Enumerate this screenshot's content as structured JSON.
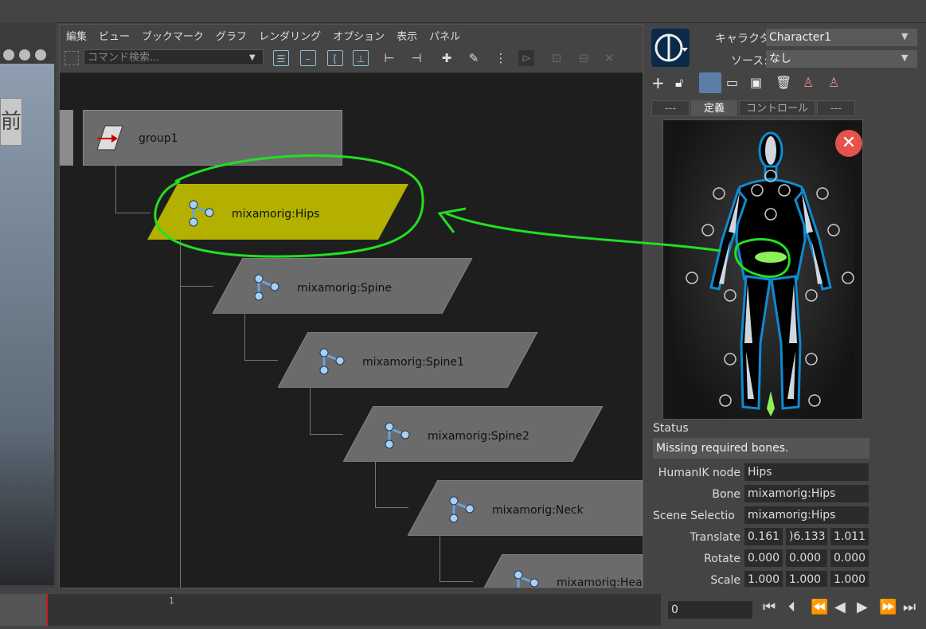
{
  "node_editor": {
    "menu": [
      "編集",
      "ビュー",
      "ブックマーク",
      "グラフ",
      "レンダリング",
      "オプション",
      "表示",
      "パネル"
    ],
    "search_placeholder": "コマンド検索..."
  },
  "nodes": [
    {
      "label": "group1",
      "selected": false
    },
    {
      "label": "mixamorig:Hips",
      "selected": true
    },
    {
      "label": "mixamorig:Spine",
      "selected": false
    },
    {
      "label": "mixamorig:Spine1",
      "selected": false
    },
    {
      "label": "mixamorig:Spine2",
      "selected": false
    },
    {
      "label": "mixamorig:Neck",
      "selected": false
    },
    {
      "label": "mixamorig:Hea",
      "selected": false
    }
  ],
  "viewport": {
    "button_text": "前"
  },
  "hik": {
    "character_label": "キャラクタ:",
    "character_value": "Character1",
    "source_label": "ソース:",
    "source_value": "なし",
    "tabs": [
      "---",
      "定義",
      "コントロール",
      "---"
    ],
    "active_tab": "定義",
    "status_header": "Status",
    "status_text": "Missing required bones.",
    "humanik_node_label": "HumanIK node",
    "humanik_node_value": "Hips",
    "bone_label": "Bone",
    "bone_value": "mixamorig:Hips",
    "scene_selection_label": "Scene Selectio",
    "scene_selection_value": "mixamorig:Hips",
    "translate_label": "Translate",
    "translate": [
      "0.161",
      ")6.133",
      "1.011"
    ],
    "rotate_label": "Rotate",
    "rotate": [
      "0.000",
      "0.000",
      "0.000"
    ],
    "scale_label": "Scale",
    "scale": [
      "1.000",
      "1.000",
      "1.000"
    ]
  },
  "timeline": {
    "frame_marker": "1",
    "current_frame": "0"
  },
  "colors": {
    "selected_node": "#b3b000",
    "node": "#6b6b6b",
    "annotation": "#22e022",
    "accent": "#8fbfd4"
  }
}
